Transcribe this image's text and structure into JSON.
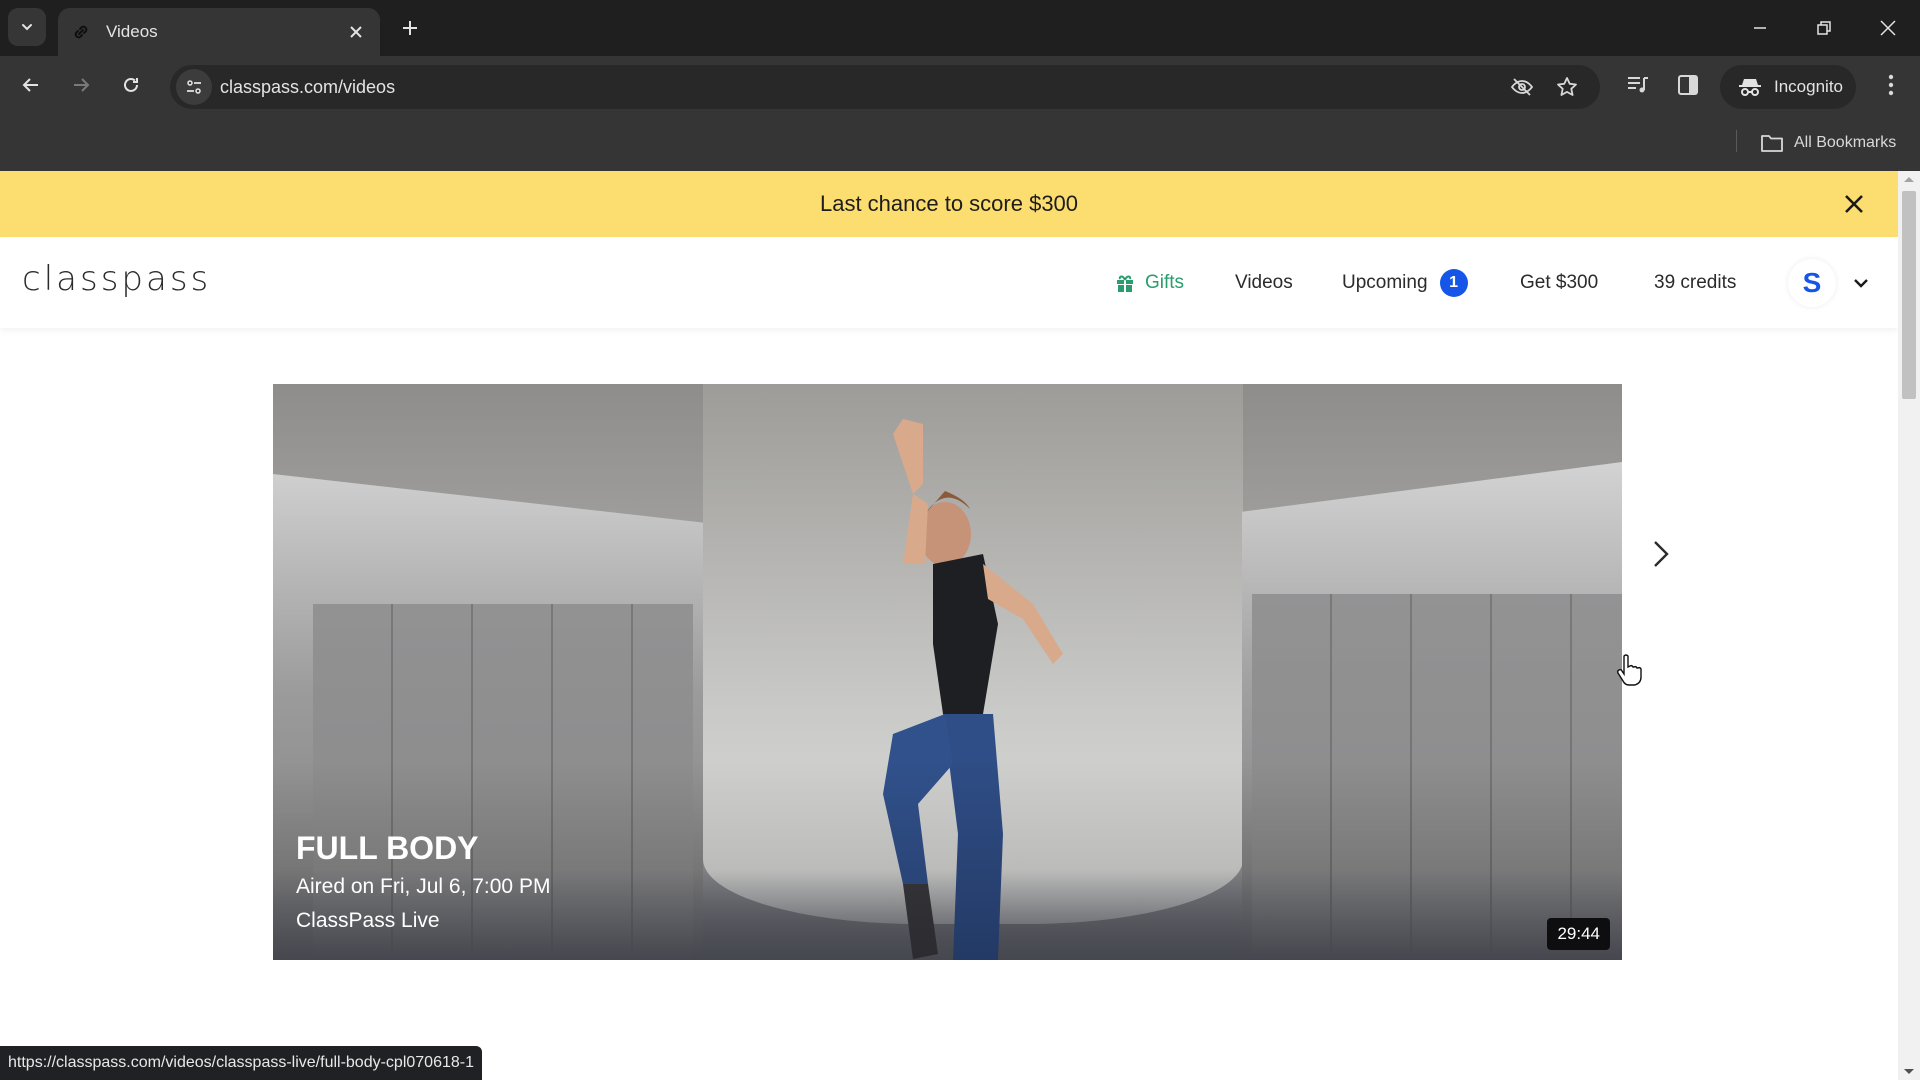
{
  "browser": {
    "tab": {
      "title": "Videos"
    },
    "address_bar": {
      "url": "classpass.com/videos"
    },
    "profile_label": "Incognito",
    "bookmarks": {
      "all_bookmarks_label": "All Bookmarks"
    },
    "status_url": "https://classpass.com/videos/classpass-live/full-body-cpl070618-1"
  },
  "promo_banner": {
    "text": "Last chance to score $300",
    "background": "#fbdd70"
  },
  "site_nav": {
    "logo": "classpass",
    "items": [
      {
        "label": "Gifts",
        "icon": "gift-icon",
        "color": "#2a9d6f"
      },
      {
        "label": "Videos"
      },
      {
        "label": "Upcoming",
        "badge": "1",
        "badge_color": "#1556e8"
      },
      {
        "label": "Get $300"
      },
      {
        "label": "39 credits"
      }
    ],
    "avatar_initial": "S",
    "accent": "#1556e8"
  },
  "hero_video": {
    "title": "FULL BODY",
    "aired": "Aired on Fri, Jul 6, 7:00 PM",
    "provider": "ClassPass Live",
    "duration": "29:44"
  }
}
